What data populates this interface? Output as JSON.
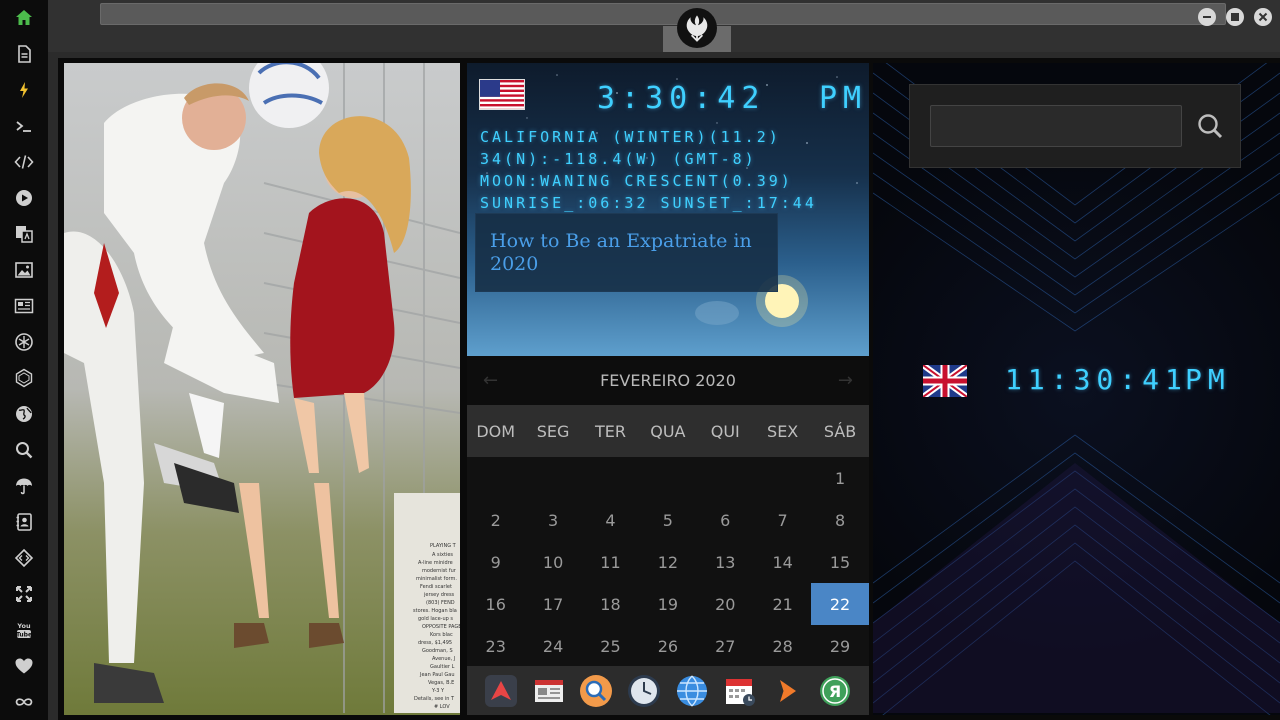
{
  "sidebar": {
    "items": [
      {
        "icon": "home-icon",
        "color": "#4cbb4c"
      },
      {
        "icon": "document-icon"
      },
      {
        "icon": "lightning-icon",
        "color": "#f2c230"
      },
      {
        "icon": "terminal-icon"
      },
      {
        "icon": "code-icon"
      },
      {
        "icon": "play-icon"
      },
      {
        "icon": "translate-icon"
      },
      {
        "icon": "image-icon"
      },
      {
        "icon": "news-icon"
      },
      {
        "icon": "rebel-alliance-icon"
      },
      {
        "icon": "hexagon-icon"
      },
      {
        "icon": "globe-icon"
      },
      {
        "icon": "search-icon"
      },
      {
        "icon": "umbrella-icon"
      },
      {
        "icon": "contact-icon"
      },
      {
        "icon": "tag-code-icon"
      },
      {
        "icon": "expand-icon"
      },
      {
        "icon": "youtube-icon"
      },
      {
        "icon": "heart-icon"
      },
      {
        "icon": "infinity-icon"
      }
    ]
  },
  "weather": {
    "time": "3:30:42",
    "ampm": "PM",
    "location": "CALIFORNIA (WINTER)(11.2)",
    "coords": "34(N):-118.4(W) (GMT-8)",
    "moon": "MOON:WANING CRESCENT(0.39)",
    "sun": "SUNRISE_:06:32 SUNSET_:17:44",
    "headline": "How to Be an Expatriate in 2020"
  },
  "calendar": {
    "month": "FEVEREIRO 2020",
    "prev": "←",
    "next": "→",
    "weekdays": [
      "DOM",
      "SEG",
      "TER",
      "QUA",
      "QUI",
      "SEX",
      "SÁB"
    ],
    "weeks": [
      [
        "",
        "",
        "",
        "",
        "",
        "",
        "1"
      ],
      [
        "2",
        "3",
        "4",
        "5",
        "6",
        "7",
        "8"
      ],
      [
        "9",
        "10",
        "11",
        "12",
        "13",
        "14",
        "15"
      ],
      [
        "16",
        "17",
        "18",
        "19",
        "20",
        "21",
        "22"
      ],
      [
        "23",
        "24",
        "25",
        "26",
        "27",
        "28",
        "29"
      ]
    ],
    "selected": "22"
  },
  "uk_clock": {
    "time": "11:30:41",
    "ampm": "PM"
  },
  "search": {
    "placeholder": ""
  },
  "dock": {
    "apps": [
      "launcher-icon",
      "news-icon",
      "search-icon",
      "clock-icon",
      "globe-icon",
      "calendar-icon",
      "arrow-icon",
      "yandex-icon"
    ]
  },
  "colors": {
    "accent": "#4a86c6",
    "digital": "#3fd0ff"
  }
}
